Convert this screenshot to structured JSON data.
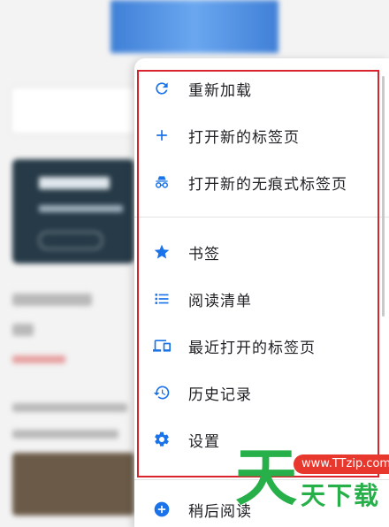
{
  "menu": {
    "items": [
      {
        "label": "重新加载",
        "icon": "reload-icon"
      },
      {
        "label": "打开新的标签页",
        "icon": "plus-icon"
      },
      {
        "label": "打开新的无痕式标签页",
        "icon": "incognito-icon"
      },
      {
        "label": "书签",
        "icon": "star-icon"
      },
      {
        "label": "阅读清单",
        "icon": "list-icon"
      },
      {
        "label": "最近打开的标签页",
        "icon": "devices-icon"
      },
      {
        "label": "历史记录",
        "icon": "history-icon"
      },
      {
        "label": "设置",
        "icon": "gear-icon"
      },
      {
        "label": "稍后阅读",
        "icon": "add-circle-icon"
      }
    ]
  },
  "colors": {
    "icon_blue": "#1a73e8",
    "icon_bg": "#e8f0fe",
    "highlight_red": "#d9232d",
    "watermark_green": "#27b04a"
  },
  "watermark": {
    "glyph": "天",
    "url": "www.TTzip.com",
    "name": "天下载"
  }
}
